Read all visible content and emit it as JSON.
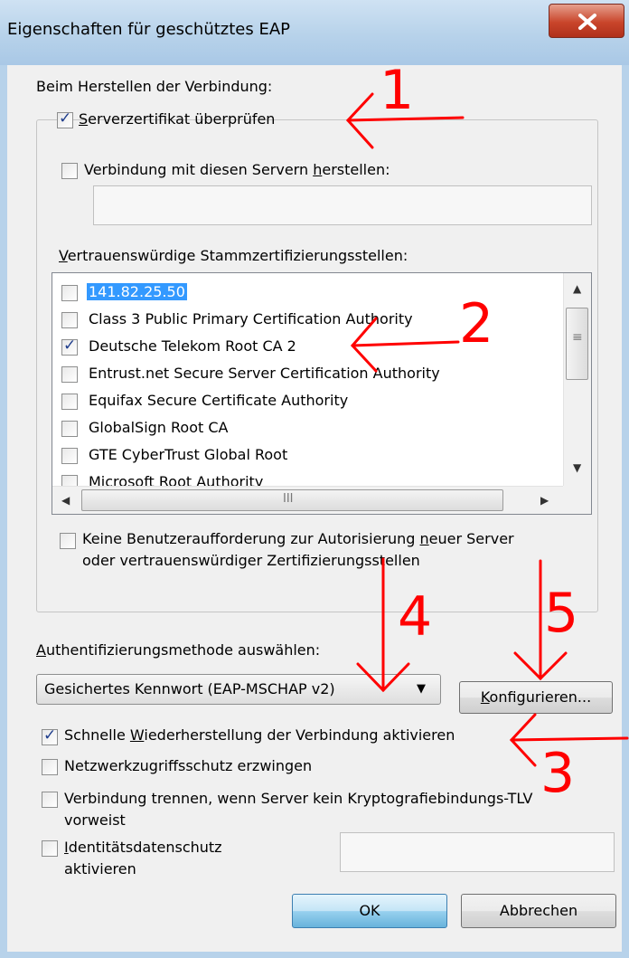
{
  "window": {
    "title": "Eigenschaften für geschütztes EAP"
  },
  "connect_heading": "Beim Herstellen der Verbindung:",
  "verify_cert": {
    "checked": true,
    "u": "S",
    "rest": "erverzertifikat überprüfen"
  },
  "connect_servers": {
    "checked": false,
    "pre": "Verbindung mit diesen Servern ",
    "u": "h",
    "rest": "erstellen:",
    "value": ""
  },
  "trusted_heading": {
    "u": "V",
    "rest": "ertrauenswürdige Stammzertifizierungsstellen:"
  },
  "ca_list": [
    {
      "label": "141.82.25.50",
      "checked": false,
      "selected": true
    },
    {
      "label": "Class 3 Public Primary Certification Authority",
      "checked": false
    },
    {
      "label": "Deutsche Telekom Root CA 2",
      "checked": true
    },
    {
      "label": "Entrust.net Secure Server Certification Authority",
      "checked": false
    },
    {
      "label": "Equifax Secure Certificate Authority",
      "checked": false
    },
    {
      "label": "GlobalSign Root CA",
      "checked": false
    },
    {
      "label": "GTE CyberTrust Global Root",
      "checked": false
    },
    {
      "label": "Microsoft Root Authority",
      "checked": false
    }
  ],
  "no_prompt": {
    "checked": false,
    "line1_pre": "Keine Benutzeraufforderung zur Autorisierung ",
    "line1_u": "n",
    "line1_rest": "euer Server",
    "line2": "oder vertrauenswürdiger Zertifizierungsstellen"
  },
  "auth_method": {
    "u": "A",
    "rest": "uthentifizierungsmethode auswählen:",
    "selected": "Gesichertes Kennwort (EAP-MSCHAP v2)"
  },
  "configure_button": {
    "u": "K",
    "rest": "onfigurieren..."
  },
  "fast_reconnect": {
    "checked": true,
    "pre": "Schnelle ",
    "u": "W",
    "rest": "iederherstellung der Verbindung aktivieren"
  },
  "nap": {
    "checked": false,
    "label": "Netzwerkzugriffsschutz erzwingen"
  },
  "disconnect": {
    "checked": false,
    "line1": "Verbindung trennen, wenn Server kein Kryptografiebindungs-TLV",
    "line2": "vorweist"
  },
  "identity_privacy": {
    "checked": false,
    "u": "I",
    "rest": "dentitätsdatenschutz",
    "line2": "aktivieren",
    "value": ""
  },
  "ok_button": "OK",
  "cancel_button": "Abbrechen",
  "annotations": {
    "n1": "1",
    "n2": "2",
    "n3": "3",
    "n4": "4",
    "n5": "5",
    "color": "#ff0000"
  },
  "colors": {
    "selection": "#3399ff",
    "check": "#1f3d8c"
  }
}
